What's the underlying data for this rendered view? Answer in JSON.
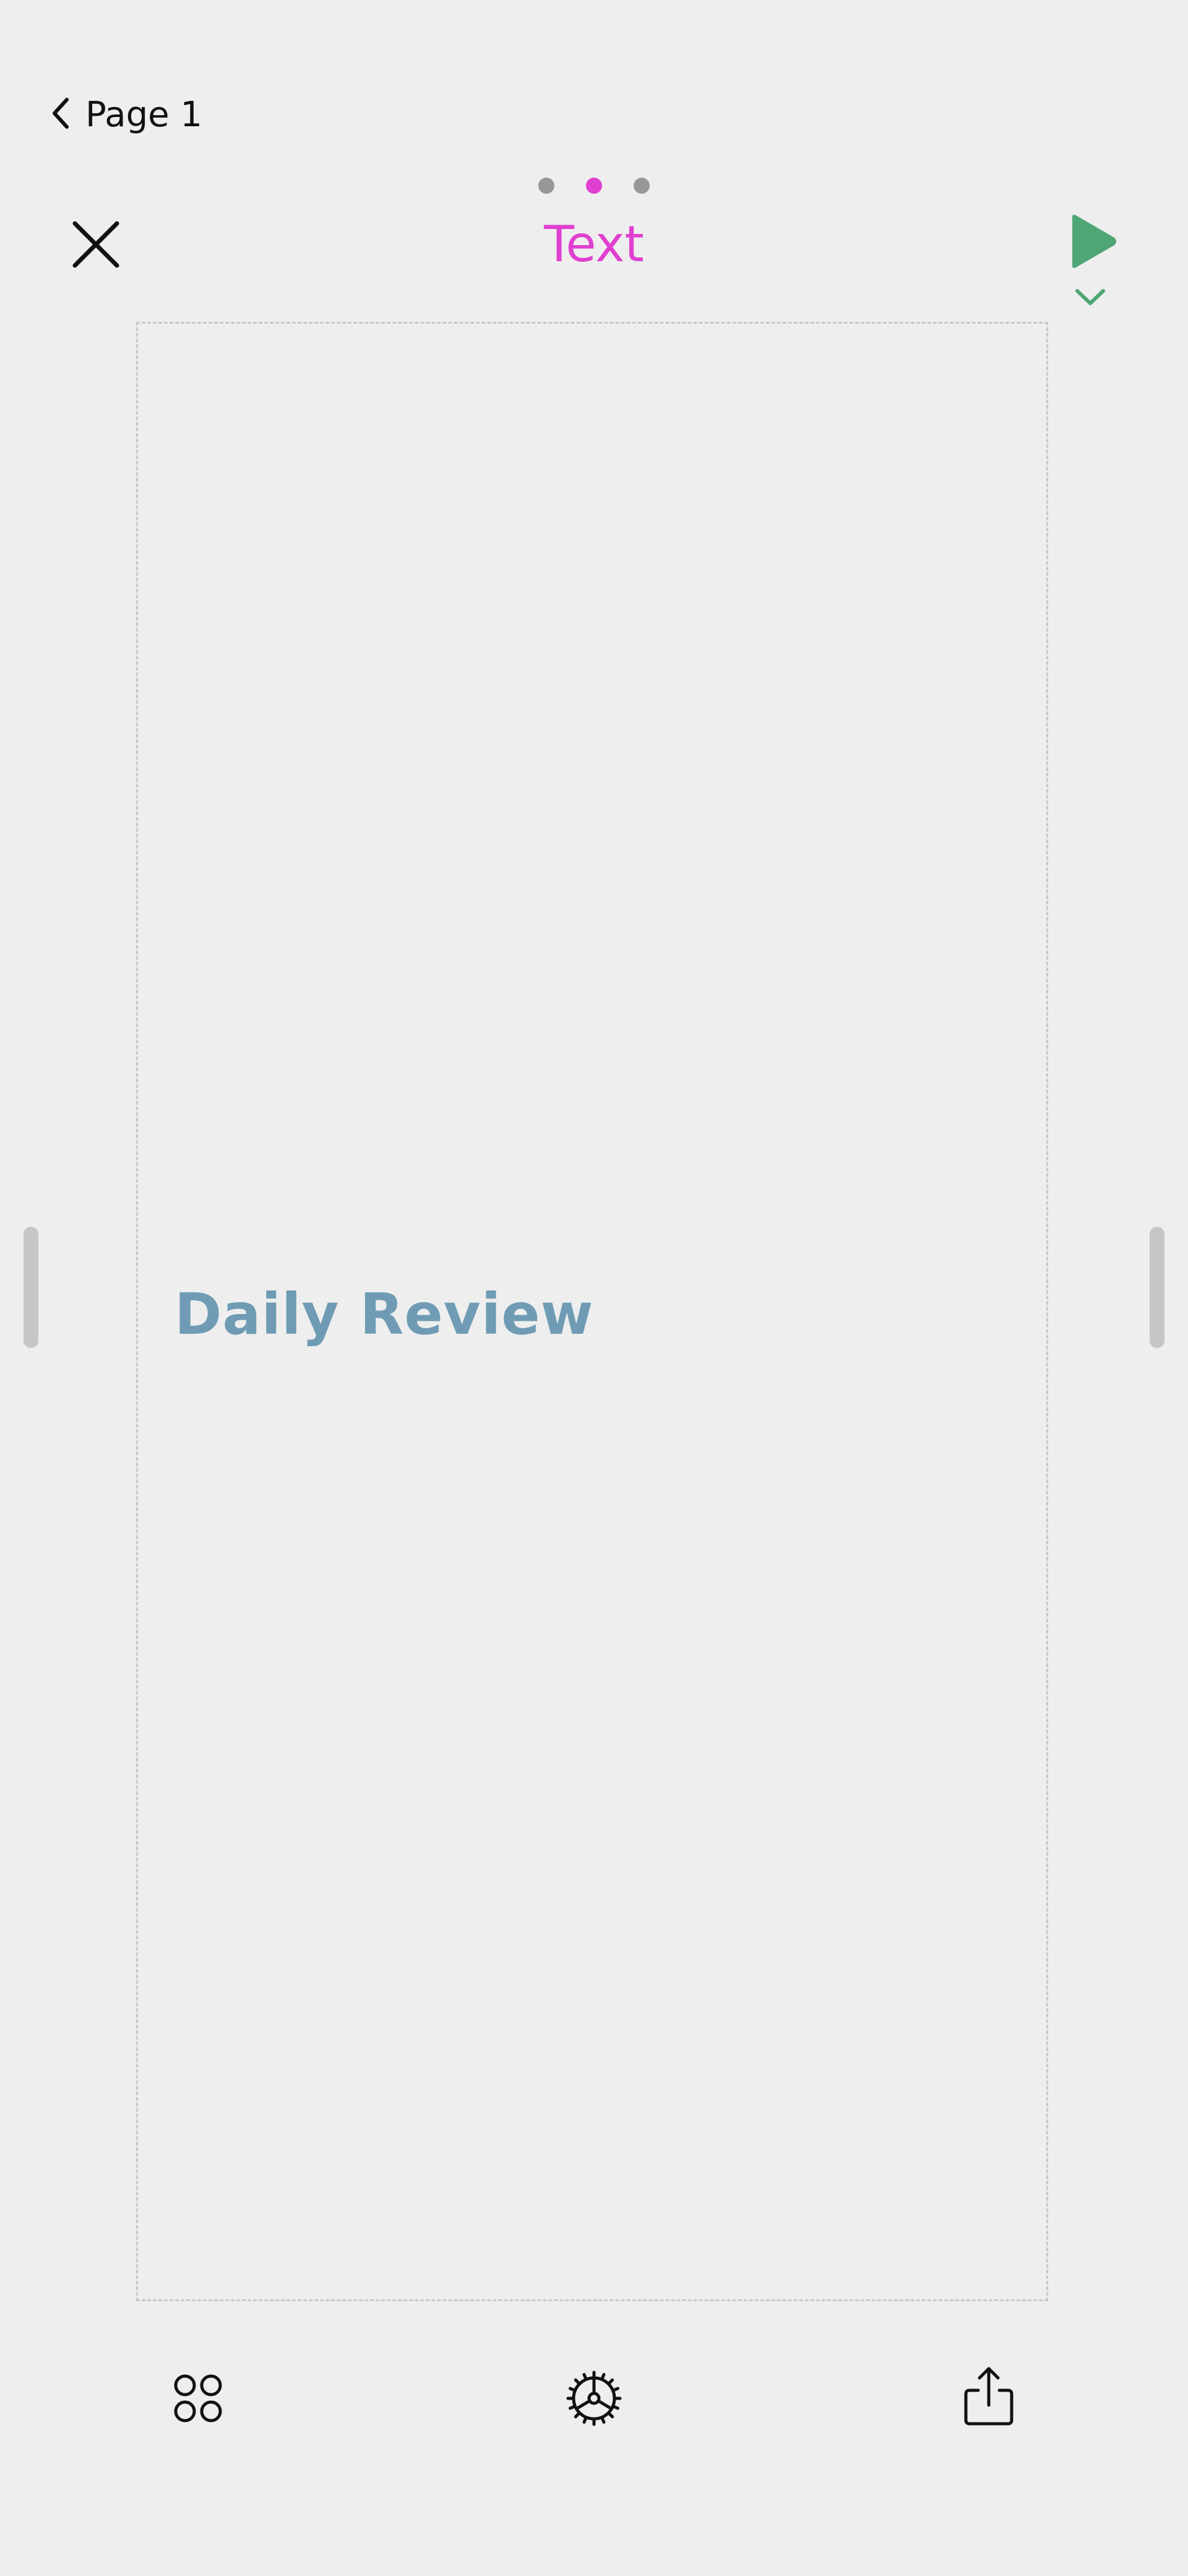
{
  "header": {
    "back_label": "Page 1",
    "mode_title": "Text",
    "page_dots": {
      "count": 3,
      "active_index": 1
    }
  },
  "canvas": {
    "text": "Daily Review"
  },
  "toolbar": {
    "icons": [
      "apps-icon",
      "gear-icon",
      "share-icon"
    ]
  },
  "colors": {
    "accent": "#e040d0",
    "play": "#4fa675",
    "canvas_text": "#6f9cb4",
    "background": "#eeeeee"
  }
}
